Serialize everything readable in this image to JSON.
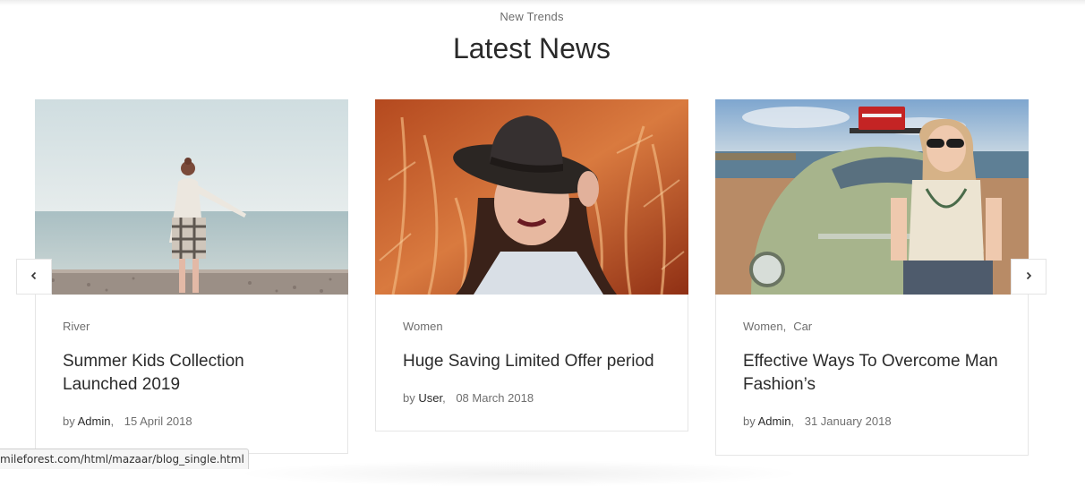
{
  "section": {
    "eyebrow": "New Trends",
    "title": "Latest News"
  },
  "cards": [
    {
      "categories": [
        "River"
      ],
      "title": "Summer Kids Collection Launched 2019",
      "by": "by",
      "author": "Admin",
      "date": "15 April 2018"
    },
    {
      "categories": [
        "Women"
      ],
      "title": "Huge Saving Limited Offer period",
      "by": "by",
      "author": "User",
      "date": "08 March 2018"
    },
    {
      "categories": [
        "Women",
        "Car"
      ],
      "title": "Effective Ways To Overcome Man Fashion’s",
      "by": "by",
      "author": "Admin",
      "date": "31 January 2018"
    }
  ],
  "nav": {
    "prev_icon": "chevron-left-icon",
    "next_icon": "chevron-right-icon"
  },
  "statusbar": {
    "url": "mileforest.com/html/mazaar/blog_single.html"
  }
}
